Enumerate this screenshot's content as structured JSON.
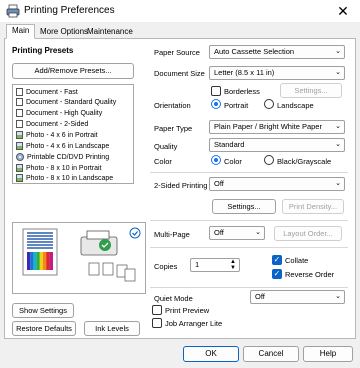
{
  "window": {
    "title": "Printing Preferences"
  },
  "tabs": [
    {
      "label": "Main",
      "active": true
    },
    {
      "label": "More Options",
      "active": false
    },
    {
      "label": "Maintenance",
      "active": false
    }
  ],
  "presets": {
    "title": "Printing Presets",
    "add_remove_label": "Add/Remove Presets...",
    "items": [
      {
        "label": "Document - Fast",
        "icon": "document-icon"
      },
      {
        "label": "Document - Standard Quality",
        "icon": "document-icon"
      },
      {
        "label": "Document - High Quality",
        "icon": "document-icon"
      },
      {
        "label": "Document - 2-Sided",
        "icon": "document-icon"
      },
      {
        "label": "Photo - 4 x 6 in Portrait",
        "icon": "photo-icon"
      },
      {
        "label": "Photo - 4 x 6 in Landscape",
        "icon": "photo-icon"
      },
      {
        "label": "Printable CD/DVD Printing",
        "icon": "disc-icon"
      },
      {
        "label": "Photo - 8 x 10 in Portrait",
        "icon": "photo-icon"
      },
      {
        "label": "Photo - 8 x 10 in Landscape",
        "icon": "photo-icon"
      }
    ]
  },
  "left_buttons": {
    "show_settings": "Show Settings",
    "restore_defaults": "Restore Defaults",
    "ink_levels": "Ink Levels"
  },
  "settings": {
    "paper_source": {
      "label": "Paper Source",
      "value": "Auto Cassette Selection"
    },
    "document_size": {
      "label": "Document Size",
      "value": "Letter (8.5 x 11 in)"
    },
    "borderless": {
      "label": "Borderless",
      "checked": false
    },
    "settings_disabled": "Settings...",
    "orientation": {
      "label": "Orientation",
      "options": [
        "Portrait",
        "Landscape"
      ],
      "selected": "Portrait"
    },
    "paper_type": {
      "label": "Paper Type",
      "value": "Plain Paper / Bright White Paper"
    },
    "quality": {
      "label": "Quality",
      "value": "Standard"
    },
    "color": {
      "label": "Color",
      "options": [
        "Color",
        "Black/Grayscale"
      ],
      "selected": "Color"
    },
    "two_sided": {
      "label": "2-Sided Printing",
      "value": "Off"
    },
    "two_sided_settings": "Settings...",
    "print_density": "Print Density...",
    "multi_page": {
      "label": "Multi-Page",
      "value": "Off"
    },
    "layout_order": "Layout Order...",
    "copies": {
      "label": "Copies",
      "value": "1"
    },
    "collate": {
      "label": "Collate",
      "checked": true
    },
    "reverse_order": {
      "label": "Reverse Order",
      "checked": true
    },
    "quiet_mode": {
      "label": "Quiet Mode",
      "value": "Off"
    },
    "print_preview": {
      "label": "Print Preview",
      "checked": false
    },
    "job_arranger": {
      "label": "Job Arranger Lite",
      "checked": false
    }
  },
  "footer": {
    "ok": "OK",
    "cancel": "Cancel",
    "help": "Help"
  },
  "colors": {
    "accent": "#0a64c8",
    "window_bg": "#f0f0f0",
    "panel_bg": "#ffffff"
  }
}
